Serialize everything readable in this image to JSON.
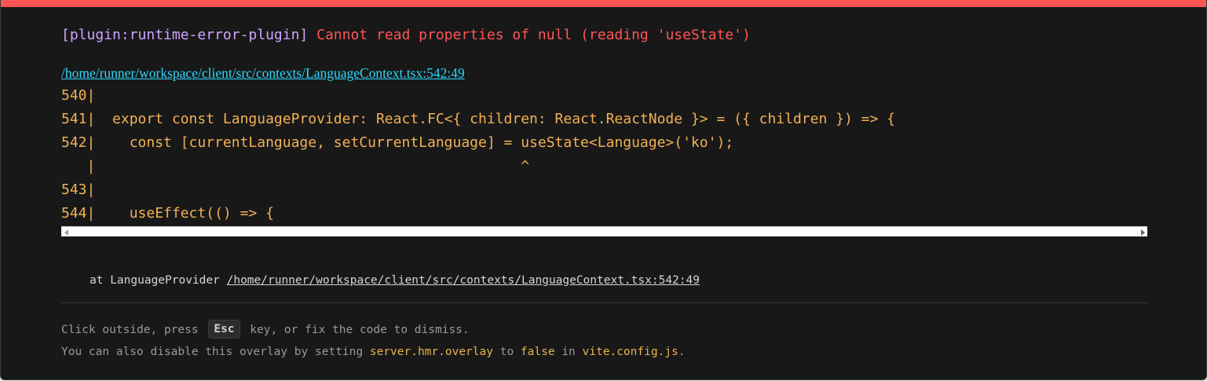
{
  "error": {
    "plugin": "[plugin:runtime-error-plugin]",
    "message": "Cannot read properties of null (reading 'useState')",
    "file": "/home/runner/workspace/client/src/contexts/LanguageContext.tsx:542:49"
  },
  "code_frame": {
    "lines": [
      "540|",
      "541|  export const LanguageProvider: React.FC<{ children: React.ReactNode }> = ({ children }) => {",
      "542|    const [currentLanguage, setCurrentLanguage] = useState<Language>('ko');",
      "   |                                                  ^",
      "543|",
      "544|    useEffect(() => {"
    ]
  },
  "stack": {
    "prefix": "at LanguageProvider",
    "link": "/home/runner/workspace/client/src/contexts/LanguageContext.tsx:542:49"
  },
  "tips": {
    "line1_before": "Click outside, press",
    "key": "Esc",
    "line1_after": "key, or fix the code to dismiss.",
    "line2_before": "You can also disable this overlay by setting",
    "setting": "server.hmr.overlay",
    "line2_to": "to",
    "value": "false",
    "line2_in": "in",
    "config": "vite.config.js",
    "line2_end": "."
  },
  "colors": {
    "top_bar": "#ff5555",
    "plugin": "#cfa4ff",
    "message": "#ff5555",
    "file_link": "#2dd9fe",
    "code": "#f2b155",
    "background": "#181818"
  }
}
